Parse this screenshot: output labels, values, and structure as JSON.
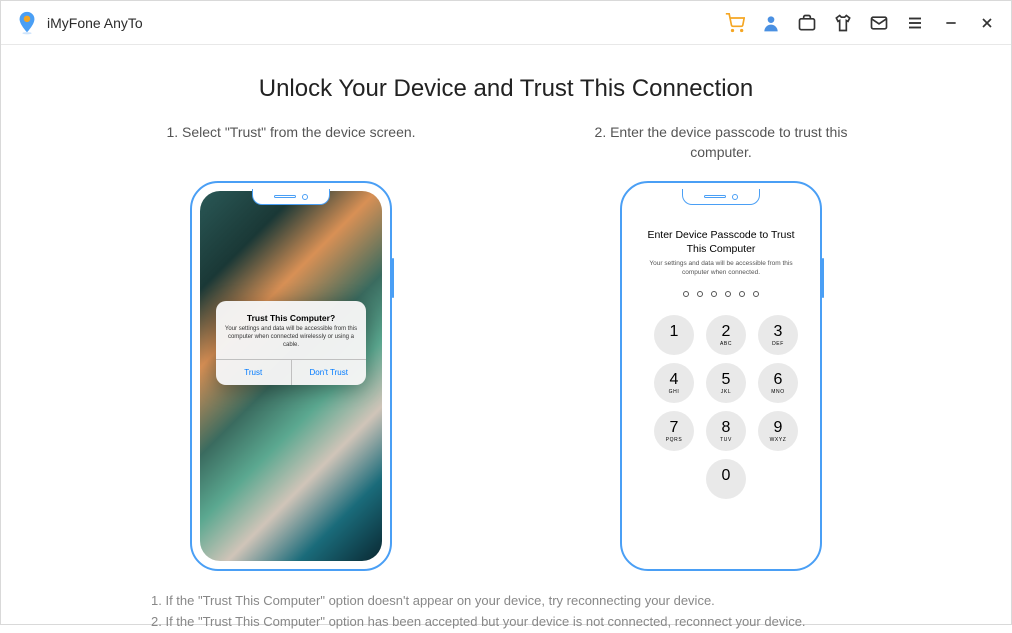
{
  "app": {
    "title": "iMyFone AnyTo"
  },
  "main": {
    "heading": "Unlock Your Device and Trust This Connection",
    "step1_label": "1. Select \"Trust\" from the device screen.",
    "step2_label": "2. Enter the device passcode to trust this computer."
  },
  "dialog": {
    "title": "Trust This Computer?",
    "text": "Your settings and data will be accessible from this computer when connected wirelessly or using a cable.",
    "trust": "Trust",
    "dont_trust": "Don't Trust"
  },
  "passcode": {
    "title": "Enter Device Passcode to Trust This Computer",
    "subtitle": "Your settings and data will be accessible from this computer when connected."
  },
  "keypad": {
    "k1": "1",
    "l1": "",
    "k2": "2",
    "l2": "ABC",
    "k3": "3",
    "l3": "DEF",
    "k4": "4",
    "l4": "GHI",
    "k5": "5",
    "l5": "JKL",
    "k6": "6",
    "l6": "MNO",
    "k7": "7",
    "l7": "PQRS",
    "k8": "8",
    "l8": "TUV",
    "k9": "9",
    "l9": "WXYZ",
    "k0": "0",
    "l0": ""
  },
  "footer": {
    "line1": "1. If the \"Trust This Computer\" option doesn't appear on your device, try reconnecting your device.",
    "line2": "2. If the \"Trust This Computer\" option has been accepted but your device is not connected, reconnect your device."
  }
}
